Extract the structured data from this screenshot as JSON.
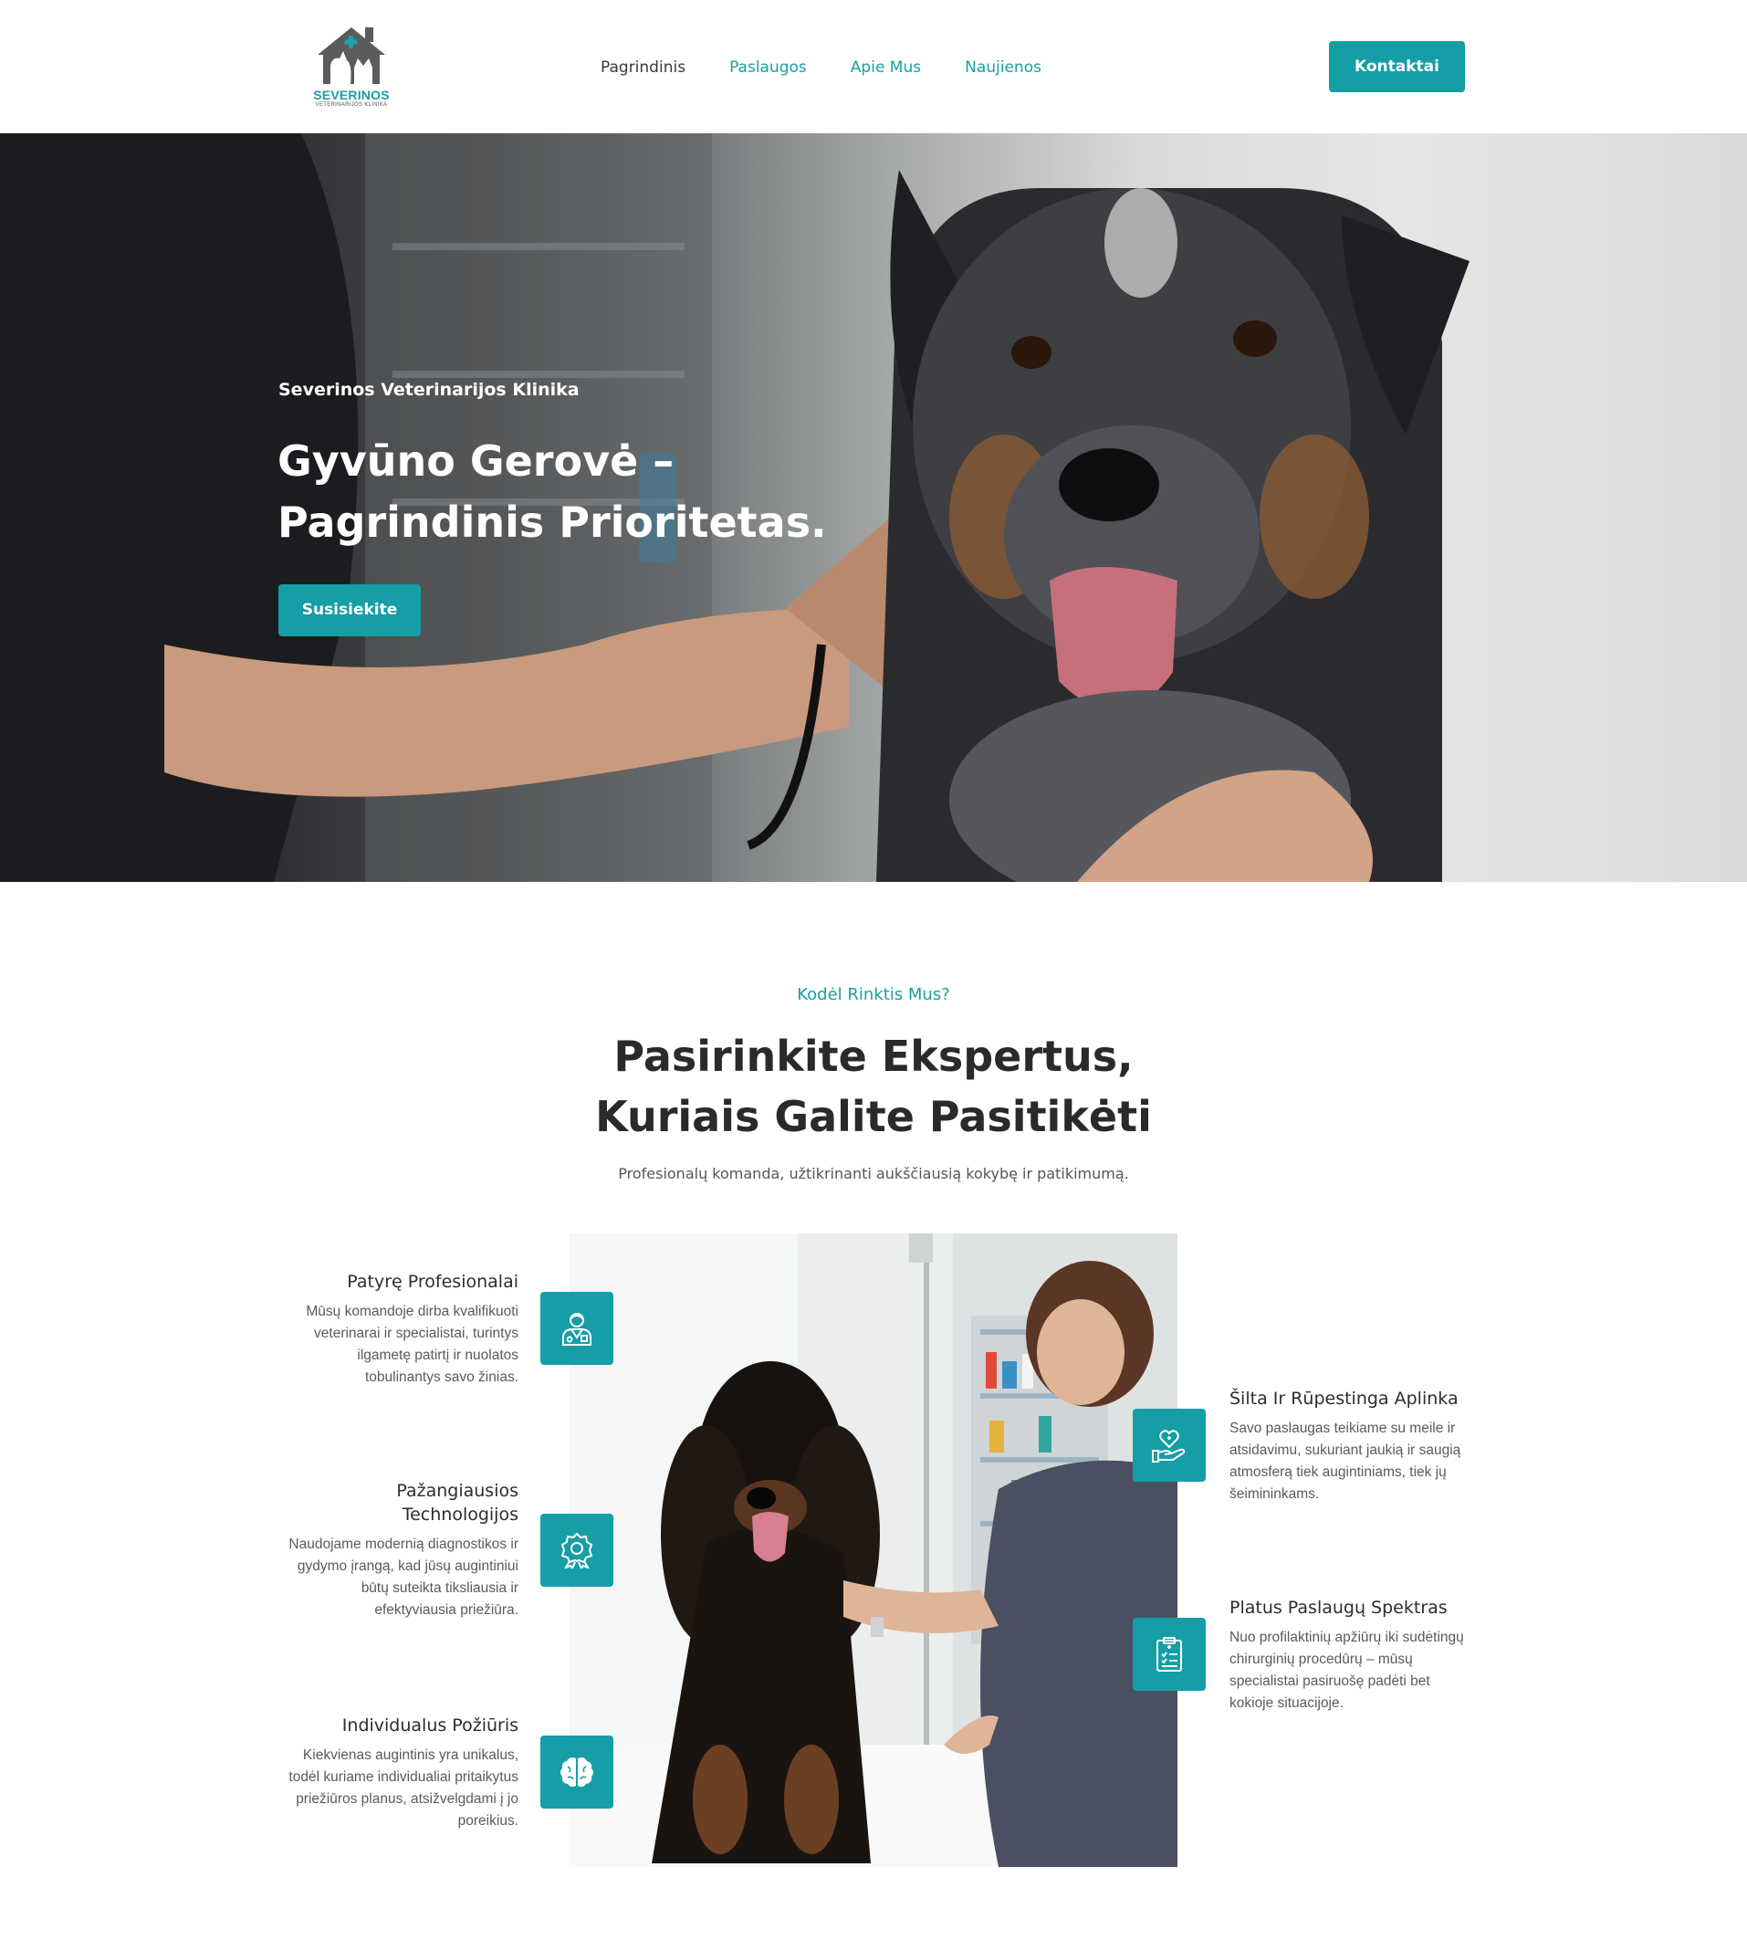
{
  "header": {
    "logo": {
      "name": "SEVERINOS",
      "subtitle": "VETERINARIJOS KLINIKA"
    },
    "nav": [
      {
        "label": "Pagrindinis",
        "active": true
      },
      {
        "label": "Paslaugos",
        "active": false
      },
      {
        "label": "Apie Mus",
        "active": false
      },
      {
        "label": "Naujienos",
        "active": false
      }
    ],
    "cta_label": "Kontaktai"
  },
  "hero": {
    "subtitle": "Severinos Veterinarijos Klinika",
    "title_line1": "Gyvūno Gerovė –",
    "title_line2": "Pagrindinis Prioritetas.",
    "button_label": "Susisiekite"
  },
  "why": {
    "kicker": "Kodėl Rinktis Mus?",
    "title_line1": "Pasirinkite Ekspertus,",
    "title_line2": "Kuriais Galite Pasitikėti",
    "description": "Profesionalų komanda, užtikrinanti aukščiausią kokybę ir patikimumą.",
    "features_left": [
      {
        "title": "Patyrę Profesionalai",
        "text": "Mūsų komandoje dirba kvalifikuoti veterinarai ir specialistai, turintys ilgametę patirtį ir nuolatos tobulinantys savo žinias.",
        "icon": "doctor-icon"
      },
      {
        "title": "Pažangiausios Technologijos",
        "text": "Naudojame modernią diagnostikos ir gydymo įrangą, kad jūsų augintiniui būtų suteikta tiksliausia ir efektyviausia priežiūra.",
        "icon": "award-badge-icon"
      },
      {
        "title": "Individualus Požiūris",
        "text": "Kiekvienas augintinis yra unikalus, todėl kuriame individualiai pritaikytus priežiūros planus, atsižvelgdami į jo poreikius.",
        "icon": "brain-icon"
      }
    ],
    "features_right": [
      {
        "title": "Šilta Ir Rūpestinga Aplinka",
        "text": "Savo paslaugas teikiame su meile ir atsidavimu, sukuriant jaukią ir saugią atmosferą tiek augintiniams, tiek jų šeimininkams.",
        "icon": "heart-hand-icon"
      },
      {
        "title": "Platus Paslaugų Spektras",
        "text": "Nuo profilaktinių apžiūrų iki sudėtingų chirurginių procedūrų – mūsų specialistai pasiruošę padėti bet kokioje situacijoje.",
        "icon": "clipboard-icon"
      }
    ]
  },
  "colors": {
    "accent": "#159ea6",
    "text_dark": "#2a2a2a",
    "text_muted": "#5a5a5a"
  }
}
